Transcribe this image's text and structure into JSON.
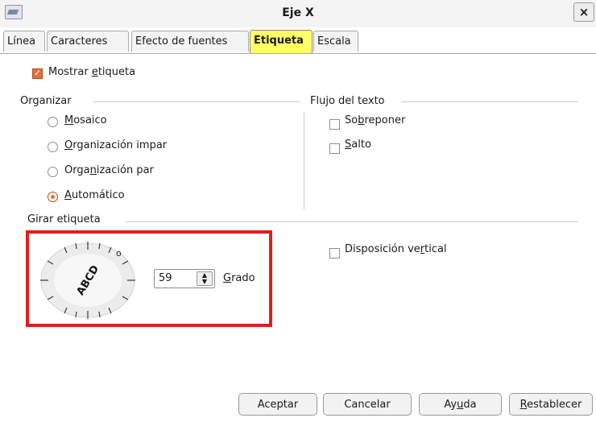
{
  "window": {
    "title": "Eje X",
    "close_glyph": "×"
  },
  "tabs": [
    {
      "label": "Línea",
      "active": false
    },
    {
      "label": "Caracteres",
      "active": false
    },
    {
      "label": "Efecto de fuentes",
      "active": false
    },
    {
      "label": "Etiqueta",
      "active": true
    },
    {
      "label": "Escala",
      "active": false
    }
  ],
  "show_label": {
    "pre": "Mostrar ",
    "u": "e",
    "post": "tiqueta",
    "checked": true
  },
  "organize": {
    "heading": "Organizar",
    "options": [
      {
        "pre": "",
        "u": "M",
        "post": "osaico",
        "selected": false
      },
      {
        "pre": "",
        "u": "O",
        "post": "rganización impar",
        "selected": false
      },
      {
        "pre": "Orga",
        "u": "n",
        "post": "ización par",
        "selected": false
      },
      {
        "pre": "",
        "u": "A",
        "post": "utomático",
        "selected": true
      }
    ]
  },
  "text_flow": {
    "heading": "Flujo del texto",
    "options": [
      {
        "pre": "So",
        "u": "b",
        "post": "reponer",
        "checked": false
      },
      {
        "pre": "",
        "u": "S",
        "post": "alto",
        "checked": false
      }
    ]
  },
  "rotate": {
    "heading": "Girar etiqueta",
    "dial_text": "ABCD",
    "dial_marker": "o",
    "angle": "59",
    "degree_label": {
      "pre": "",
      "u": "G",
      "post": "rado"
    },
    "vertical": {
      "pre": "Disposición ve",
      "u": "r",
      "post": "tical",
      "checked": false
    }
  },
  "buttons": {
    "ok": "Aceptar",
    "cancel": "Cancelar",
    "help": {
      "pre": "Ay",
      "u": "u",
      "post": "da"
    },
    "reset": {
      "pre": "",
      "u": "R",
      "post": "establecer"
    }
  },
  "colors": {
    "highlight_box": "#e31c1c",
    "active_tab": "#ffff66",
    "accent": "#e46e3d"
  }
}
